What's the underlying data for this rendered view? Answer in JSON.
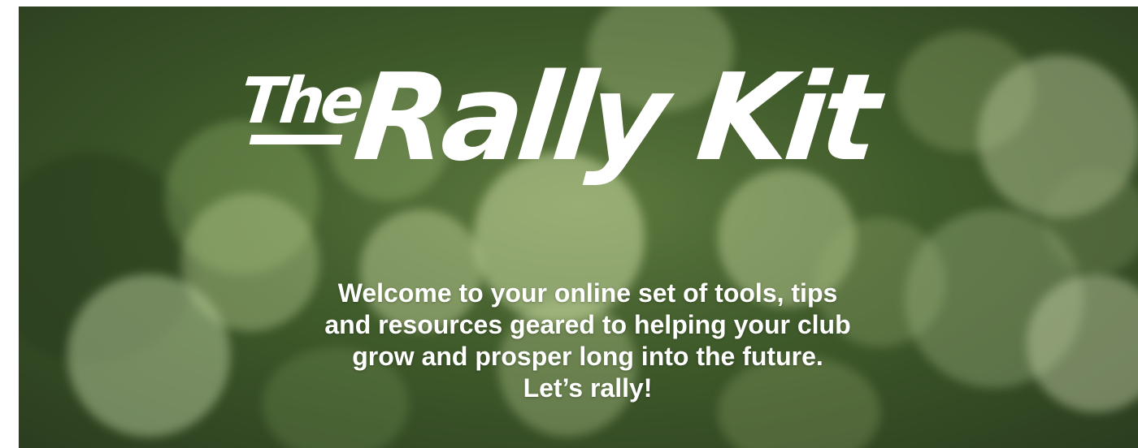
{
  "hero": {
    "logo": {
      "the": "The",
      "main": "Rally Kit"
    },
    "tagline": [
      "Welcome to your online set of tools, tips",
      "and resources geared to helping your club",
      "grow and prosper long into the future.",
      "Let’s rally!"
    ]
  },
  "colors": {
    "text": "#ffffff",
    "background_green": "#4a6633"
  }
}
